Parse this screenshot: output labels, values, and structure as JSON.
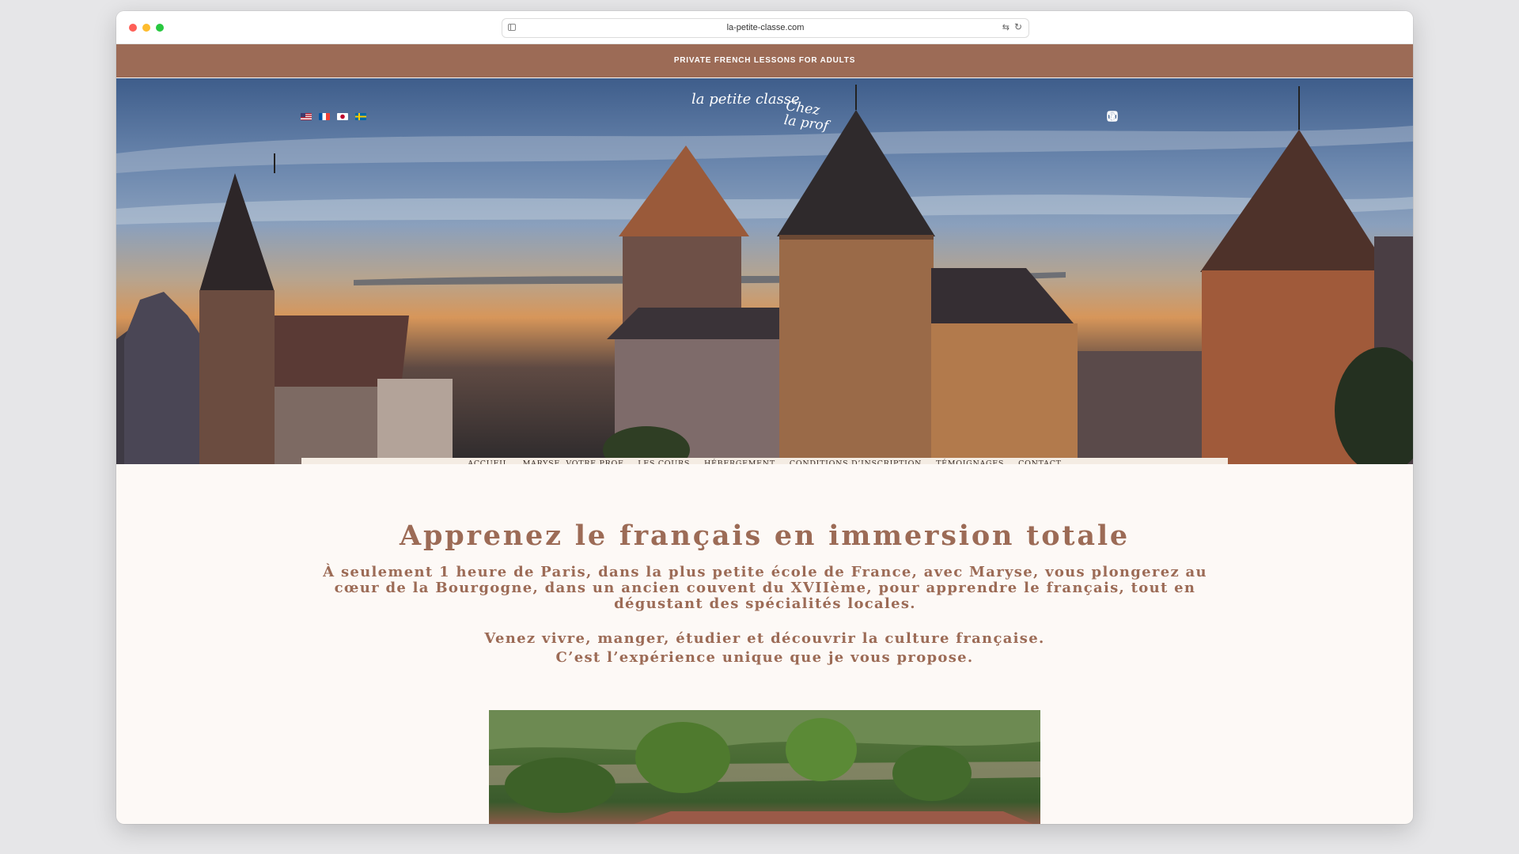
{
  "browser": {
    "url": "la-petite-classe.com"
  },
  "promo_banner": {
    "text": "PRIVATE FRENCH LESSONS FOR ADULTS"
  },
  "header": {
    "languages": [
      "en",
      "fr",
      "ja",
      "sv"
    ],
    "logo": {
      "line1": "la petite classe",
      "line2": "Chez la prof"
    },
    "social_icons": [
      "facebook-icon",
      "linkedin-icon",
      "instagram-icon",
      "youtube-icon",
      "email-icon"
    ]
  },
  "nav": {
    "items": [
      "ACCUEIL",
      "MARYSE, VOTRE PROF",
      "LES COURS",
      "HÉBERGEMENT",
      "CONDITIONS D’INSCRIPTION",
      "TÉMOIGNAGES",
      "CONTACT"
    ]
  },
  "main": {
    "title": "Apprenez le français en immersion totale",
    "intro": "À seulement 1 heure de Paris, dans la plus petite école de France, avec Maryse, vous plongerez au cœur de la Bourgogne, dans un ancien couvent du XVIIème, pour apprendre le français, tout en dégustant des spécialités locales.",
    "line_a": "Venez vivre, manger, étudier et découvrir la culture française.",
    "line_b": "C’est l’expérience unique que je vous propose."
  },
  "colors": {
    "brand": "#9c6b56",
    "nav_bg": "#f4ece3",
    "page_bg": "#fdf9f6"
  }
}
